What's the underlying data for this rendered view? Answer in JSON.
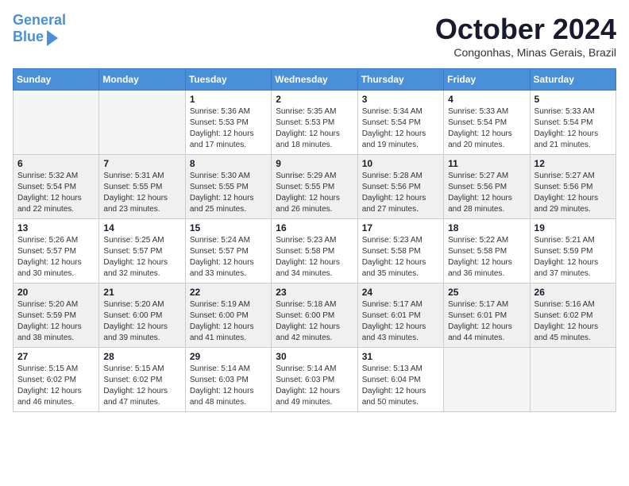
{
  "header": {
    "logo_line1": "General",
    "logo_line2": "Blue",
    "month_title": "October 2024",
    "subtitle": "Congonhas, Minas Gerais, Brazil"
  },
  "weekdays": [
    "Sunday",
    "Monday",
    "Tuesday",
    "Wednesday",
    "Thursday",
    "Friday",
    "Saturday"
  ],
  "weeks": [
    [
      {
        "day": "",
        "empty": true
      },
      {
        "day": "",
        "empty": true
      },
      {
        "day": "1",
        "sunrise": "5:36 AM",
        "sunset": "5:53 PM",
        "daylight": "12 hours and 17 minutes."
      },
      {
        "day": "2",
        "sunrise": "5:35 AM",
        "sunset": "5:53 PM",
        "daylight": "12 hours and 18 minutes."
      },
      {
        "day": "3",
        "sunrise": "5:34 AM",
        "sunset": "5:54 PM",
        "daylight": "12 hours and 19 minutes."
      },
      {
        "day": "4",
        "sunrise": "5:33 AM",
        "sunset": "5:54 PM",
        "daylight": "12 hours and 20 minutes."
      },
      {
        "day": "5",
        "sunrise": "5:33 AM",
        "sunset": "5:54 PM",
        "daylight": "12 hours and 21 minutes."
      }
    ],
    [
      {
        "day": "6",
        "sunrise": "5:32 AM",
        "sunset": "5:54 PM",
        "daylight": "12 hours and 22 minutes."
      },
      {
        "day": "7",
        "sunrise": "5:31 AM",
        "sunset": "5:55 PM",
        "daylight": "12 hours and 23 minutes."
      },
      {
        "day": "8",
        "sunrise": "5:30 AM",
        "sunset": "5:55 PM",
        "daylight": "12 hours and 25 minutes."
      },
      {
        "day": "9",
        "sunrise": "5:29 AM",
        "sunset": "5:55 PM",
        "daylight": "12 hours and 26 minutes."
      },
      {
        "day": "10",
        "sunrise": "5:28 AM",
        "sunset": "5:56 PM",
        "daylight": "12 hours and 27 minutes."
      },
      {
        "day": "11",
        "sunrise": "5:27 AM",
        "sunset": "5:56 PM",
        "daylight": "12 hours and 28 minutes."
      },
      {
        "day": "12",
        "sunrise": "5:27 AM",
        "sunset": "5:56 PM",
        "daylight": "12 hours and 29 minutes."
      }
    ],
    [
      {
        "day": "13",
        "sunrise": "5:26 AM",
        "sunset": "5:57 PM",
        "daylight": "12 hours and 30 minutes."
      },
      {
        "day": "14",
        "sunrise": "5:25 AM",
        "sunset": "5:57 PM",
        "daylight": "12 hours and 32 minutes."
      },
      {
        "day": "15",
        "sunrise": "5:24 AM",
        "sunset": "5:57 PM",
        "daylight": "12 hours and 33 minutes."
      },
      {
        "day": "16",
        "sunrise": "5:23 AM",
        "sunset": "5:58 PM",
        "daylight": "12 hours and 34 minutes."
      },
      {
        "day": "17",
        "sunrise": "5:23 AM",
        "sunset": "5:58 PM",
        "daylight": "12 hours and 35 minutes."
      },
      {
        "day": "18",
        "sunrise": "5:22 AM",
        "sunset": "5:58 PM",
        "daylight": "12 hours and 36 minutes."
      },
      {
        "day": "19",
        "sunrise": "5:21 AM",
        "sunset": "5:59 PM",
        "daylight": "12 hours and 37 minutes."
      }
    ],
    [
      {
        "day": "20",
        "sunrise": "5:20 AM",
        "sunset": "5:59 PM",
        "daylight": "12 hours and 38 minutes."
      },
      {
        "day": "21",
        "sunrise": "5:20 AM",
        "sunset": "6:00 PM",
        "daylight": "12 hours and 39 minutes."
      },
      {
        "day": "22",
        "sunrise": "5:19 AM",
        "sunset": "6:00 PM",
        "daylight": "12 hours and 41 minutes."
      },
      {
        "day": "23",
        "sunrise": "5:18 AM",
        "sunset": "6:00 PM",
        "daylight": "12 hours and 42 minutes."
      },
      {
        "day": "24",
        "sunrise": "5:17 AM",
        "sunset": "6:01 PM",
        "daylight": "12 hours and 43 minutes."
      },
      {
        "day": "25",
        "sunrise": "5:17 AM",
        "sunset": "6:01 PM",
        "daylight": "12 hours and 44 minutes."
      },
      {
        "day": "26",
        "sunrise": "5:16 AM",
        "sunset": "6:02 PM",
        "daylight": "12 hours and 45 minutes."
      }
    ],
    [
      {
        "day": "27",
        "sunrise": "5:15 AM",
        "sunset": "6:02 PM",
        "daylight": "12 hours and 46 minutes."
      },
      {
        "day": "28",
        "sunrise": "5:15 AM",
        "sunset": "6:02 PM",
        "daylight": "12 hours and 47 minutes."
      },
      {
        "day": "29",
        "sunrise": "5:14 AM",
        "sunset": "6:03 PM",
        "daylight": "12 hours and 48 minutes."
      },
      {
        "day": "30",
        "sunrise": "5:14 AM",
        "sunset": "6:03 PM",
        "daylight": "12 hours and 49 minutes."
      },
      {
        "day": "31",
        "sunrise": "5:13 AM",
        "sunset": "6:04 PM",
        "daylight": "12 hours and 50 minutes."
      },
      {
        "day": "",
        "empty": true
      },
      {
        "day": "",
        "empty": true
      }
    ]
  ]
}
